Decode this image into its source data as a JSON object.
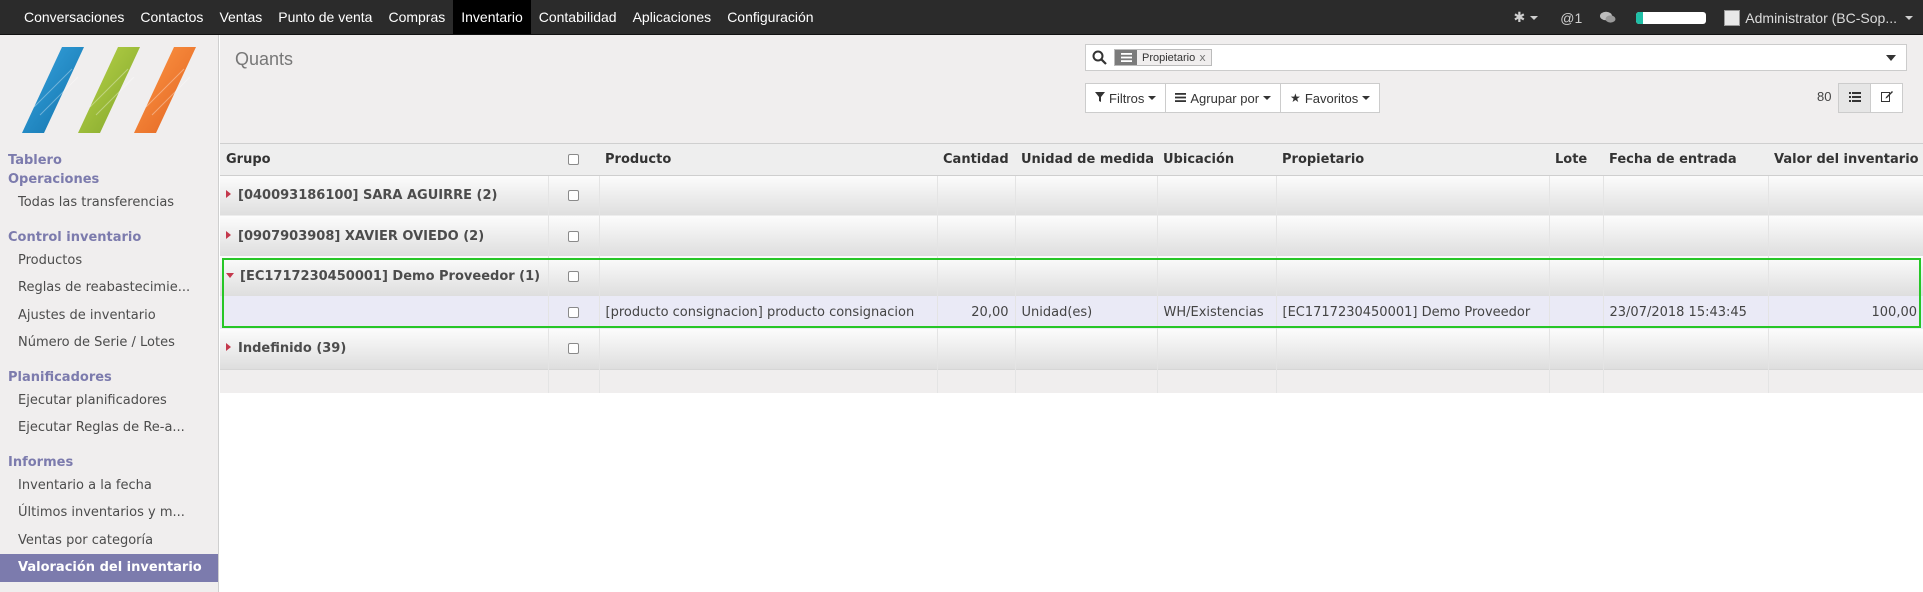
{
  "topbar": {
    "menu": [
      "Conversaciones",
      "Contactos",
      "Ventas",
      "Punto de venta",
      "Compras",
      "Inventario",
      "Contabilidad",
      "Aplicaciones",
      "Configuración"
    ],
    "active_menu": "Inventario",
    "mentions": "@1",
    "user": "Administrator (BC-Sop...",
    "progress_fraction": 0.1,
    "accent": "#1fbfa6"
  },
  "sidebar": {
    "sections": [
      {
        "header": "Tablero",
        "items": []
      },
      {
        "header": "Operaciones",
        "items": [
          "Todas las transferencias"
        ]
      },
      {
        "header": "Control inventario",
        "items": [
          "Productos",
          "Reglas de reabastecimie...",
          "Ajustes de inventario",
          "Número de Serie / Lotes"
        ]
      },
      {
        "header": "Planificadores",
        "items": [
          "Ejecutar planificadores",
          "Ejecutar Reglas de Re-a..."
        ]
      },
      {
        "header": "Informes",
        "items": [
          "Inventario a la fecha",
          "Últimos inventarios y m...",
          "Ventas por categoría",
          "Valoración del inventario"
        ]
      }
    ],
    "active_item": "Valoración del inventario",
    "accent": "#7c7bad",
    "logo_colors": [
      "#1e88c7",
      "#9cc23a",
      "#f07a30"
    ]
  },
  "control_panel": {
    "title": "Quants",
    "search_facet": "Propietario",
    "filters_label": "Filtros",
    "group_by_label": "Agrupar por",
    "favorites_label": "Favoritos",
    "pager": "80"
  },
  "list": {
    "columns": [
      "Grupo",
      "Producto",
      "Cantidad",
      "Unidad de medida",
      "Ubicación",
      "Propietario",
      "Lote",
      "Fecha de entrada",
      "Valor del inventario"
    ],
    "groups": [
      {
        "label": "[040093186100] SARA AGUIRRE (2)",
        "expanded": false
      },
      {
        "label": "[0907903908] XAVIER OVIEDO (2)",
        "expanded": false
      },
      {
        "label": "[EC1717230450001] Demo Proveedor (1)",
        "expanded": true
      },
      {
        "label": "Indefinido (39)",
        "expanded": false
      }
    ],
    "record": {
      "producto": "[producto consignacion] producto consignacion",
      "cantidad": "20,00",
      "unidad": "Unidad(es)",
      "ubicacion": "WH/Existencias",
      "propietario": "[EC1717230450001] Demo Proveedor",
      "lote": "",
      "fecha": "23/07/2018 15:43:45",
      "valor": "100,00"
    },
    "highlight_color": "#27c627"
  }
}
